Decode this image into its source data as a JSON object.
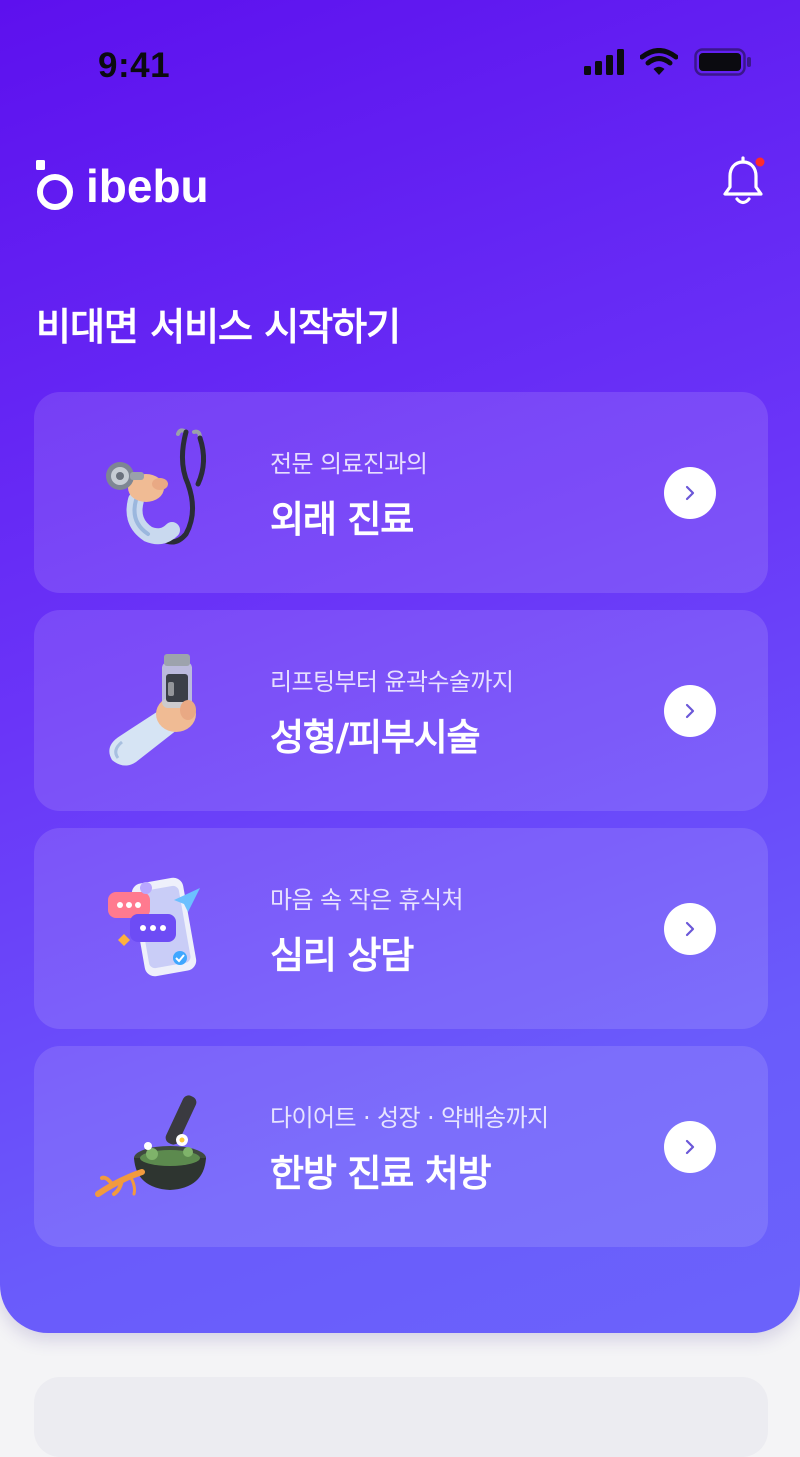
{
  "status": {
    "time": "9:41"
  },
  "brand": {
    "name": "ibebu",
    "notification_dot_color": "#ff2b2b"
  },
  "main": {
    "title": "비대면 서비스 시작하기",
    "cards": [
      {
        "subtitle": "전문 의료진과의",
        "title": "외래 진료",
        "icon": "stethoscope-hand-icon"
      },
      {
        "subtitle": "리프팅부터 윤곽수술까지",
        "title": "성형/피부시술",
        "icon": "vial-hand-icon"
      },
      {
        "subtitle": "마음 속 작은 휴식처",
        "title": "심리 상담",
        "icon": "phone-chat-icon"
      },
      {
        "subtitle": "다이어트 · 성장 · 약배송까지",
        "title": "한방 진료 처방",
        "icon": "herbal-mortar-icon"
      }
    ]
  },
  "colors": {
    "gradient_start": "#5d10ee",
    "gradient_end": "#6b63fb",
    "arrow_color": "#6b57d8"
  }
}
